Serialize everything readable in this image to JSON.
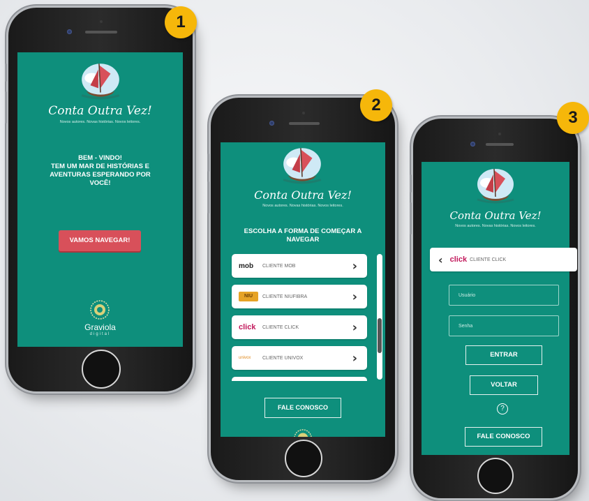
{
  "app": {
    "title": "Conta Outra Vez!",
    "tagline": "Novos autores. Novas histórias. Novos leitores."
  },
  "steps": [
    "1",
    "2",
    "3"
  ],
  "screen1": {
    "welcome_lines": [
      "BEM - VINDO!",
      "TEM UM MAR DE HISTÓRIAS E",
      "AVENTURAS ESPERANDO POR",
      "VOCÊ!"
    ],
    "start_button": "VAMOS NAVEGAR!",
    "brand_name": "Graviola",
    "brand_sub": "digital"
  },
  "screen2": {
    "heading_lines": [
      "ESCOLHA A FORMA DE COMEÇAR A",
      "NAVEGAR"
    ],
    "providers": [
      {
        "logo": "mob",
        "label": "CLIENTE MOB"
      },
      {
        "logo": "NIU",
        "label": "CLIENTE NIUFIBRA"
      },
      {
        "logo": "click",
        "label": "CLIENTE CLICK"
      },
      {
        "logo": "univox",
        "label": "CLIENTE UNIVOX"
      }
    ],
    "contact_button": "FALE CONOSCO"
  },
  "screen3": {
    "selected_logo": "click",
    "selected_label": "CLIENTE CLICK",
    "username_placeholder": "Usuário",
    "password_placeholder": "Senha",
    "login_button": "ENTRAR",
    "back_button": "VOLTAR",
    "help_icon": "?",
    "contact_button": "FALE CONOSCO"
  },
  "colors": {
    "screen_bg": "#0e8f7c",
    "accent_red": "#d8505a",
    "badge": "#f6b70a",
    "click_brand": "#c2185b"
  }
}
